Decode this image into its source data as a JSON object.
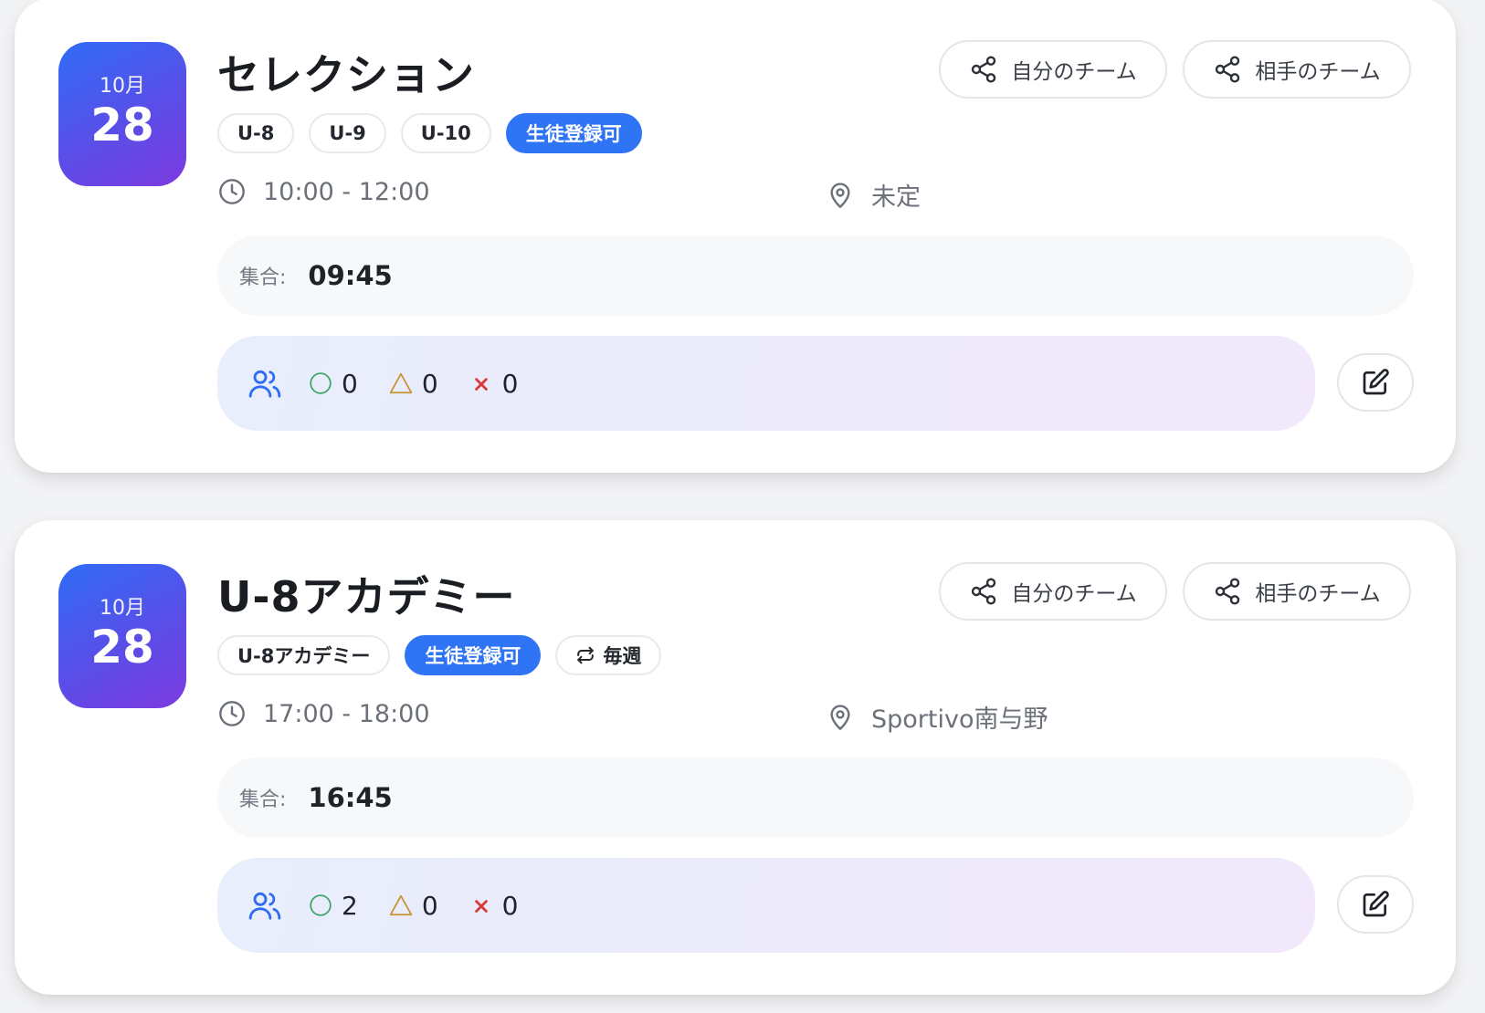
{
  "events": [
    {
      "month": "10月",
      "day": "28",
      "title": "セレクション",
      "share_mine_label": "自分のチーム",
      "share_theirs_label": "相手のチーム",
      "chips": [
        "U-8",
        "U-9",
        "U-10"
      ],
      "badge": "生徒登録可",
      "time": "10:00 - 12:00",
      "location": "未定",
      "gather_label": "集合:",
      "gather_time": "09:45",
      "attend_yes": "0",
      "attend_maybe": "0",
      "attend_no": "0"
    },
    {
      "month": "10月",
      "day": "28",
      "title": "U-8アカデミー",
      "share_mine_label": "自分のチーム",
      "share_theirs_label": "相手のチーム",
      "chips": [
        "U-8アカデミー"
      ],
      "badge": "生徒登録可",
      "recurrence": "毎週",
      "time": "17:00 - 18:00",
      "location": "Sportivo南与野",
      "gather_label": "集合:",
      "gather_time": "16:45",
      "attend_yes": "2",
      "attend_maybe": "0",
      "attend_no": "0"
    }
  ],
  "colors": {
    "date_gradient_start": "#2f6cf6",
    "date_gradient_end": "#7d3ae0",
    "badge_blue": "#2f74f5",
    "yes_green": "#3ea563",
    "maybe_amber": "#c8922f",
    "no_red": "#d93a3a",
    "people_icon_blue": "#2f6cf6"
  },
  "icons": {
    "share": "share-icon",
    "clock": "clock-icon",
    "location": "map-pin-icon",
    "people": "users-icon",
    "edit": "edit-icon",
    "recurrence": "repeat-icon"
  }
}
